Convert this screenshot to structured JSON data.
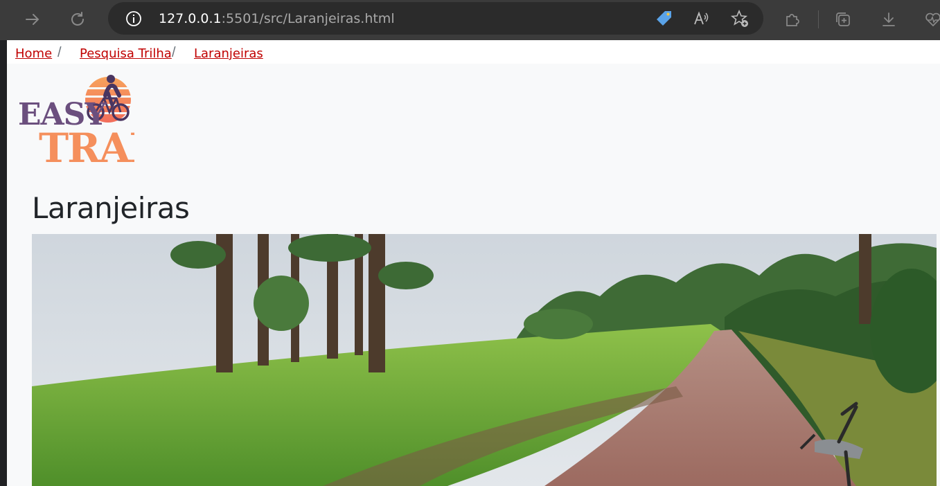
{
  "browser": {
    "url_host": "127.0.0.1",
    "url_path": ":5501/src/Laranjeiras.html",
    "icons": [
      "back-icon",
      "refresh-icon",
      "info-icon",
      "tag-icon",
      "read-aloud-icon",
      "favorites-add-icon",
      "extensions-icon",
      "collections-icon",
      "download-icon",
      "heartbeat-icon"
    ]
  },
  "breadcrumb": {
    "items": [
      {
        "label": "Home"
      },
      {
        "label": "Pesquisa Trilha"
      },
      {
        "label": "Laranjeiras"
      }
    ],
    "separator": "/"
  },
  "logo": {
    "line1": "EASY",
    "line2": "TRAIL"
  },
  "page": {
    "title": "Laranjeiras"
  },
  "colors": {
    "link": "#c00000",
    "logo_purple": "#6b4f7e",
    "logo_orange": "#f58f5c"
  }
}
